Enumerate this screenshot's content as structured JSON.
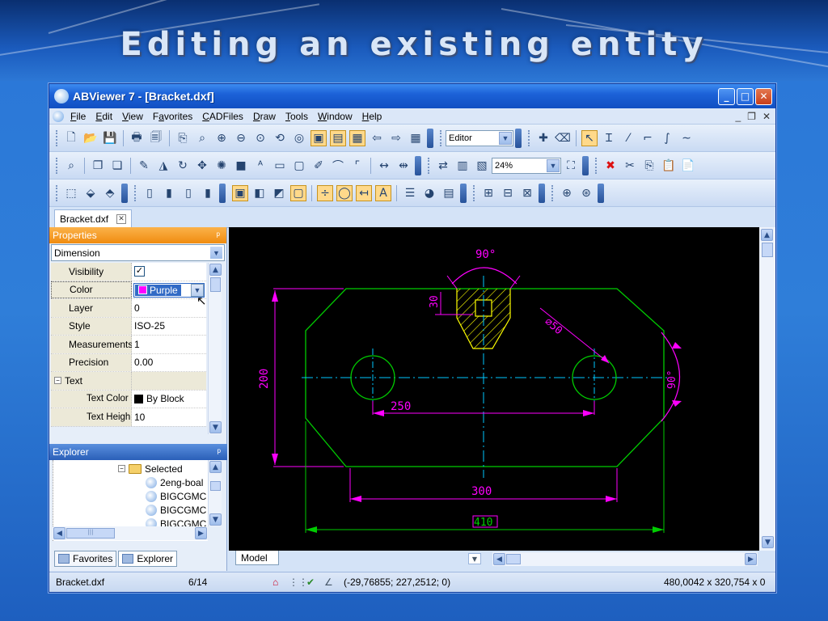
{
  "slide": {
    "title": "Editing an existing entity"
  },
  "window": {
    "title": "ABViewer 7 - [Bracket.dxf]",
    "buttons": {
      "minimize": "_",
      "maximize": "□",
      "close": "✕"
    }
  },
  "menu": {
    "items": [
      "File",
      "Edit",
      "View",
      "Favorites",
      "CADFiles",
      "Draw",
      "Tools",
      "Window",
      "Help"
    ],
    "accel": [
      "F",
      "E",
      "V",
      "a",
      "C",
      "D",
      "T",
      "W",
      "H"
    ],
    "mdi": {
      "minimize": "_",
      "restore": "❐",
      "close": "✕"
    }
  },
  "toolbar": {
    "mode_combo": "Editor",
    "zoom_combo": "24%"
  },
  "doc_tabs": [
    {
      "label": "Bracket.dxf"
    }
  ],
  "properties": {
    "header": "Properties",
    "pin": "ᵖ",
    "entity_type": "Dimension",
    "rows": [
      {
        "name": "Visibility",
        "value": "✓",
        "kind": "check"
      },
      {
        "name": "Color",
        "value": "Purple",
        "kind": "color-select",
        "color": "#ff00ff"
      },
      {
        "name": "Layer",
        "value": "0"
      },
      {
        "name": "Style",
        "value": "ISO-25"
      },
      {
        "name": "Measurements",
        "value": "1"
      },
      {
        "name": "Precision",
        "value": "0.00"
      },
      {
        "name": "Text",
        "value": "",
        "kind": "group",
        "expander": "−"
      },
      {
        "name": "Text Color",
        "value": "By Block",
        "kind": "swatch",
        "color": "#000000",
        "sub": true
      },
      {
        "name": "Text Heigh",
        "value": "10",
        "sub": true
      }
    ]
  },
  "explorer": {
    "header": "Explorer",
    "pin": "ᵖ",
    "items": [
      {
        "label": "Selected",
        "type": "folder",
        "expander": "−"
      },
      {
        "label": "2eng-boal",
        "type": "file"
      },
      {
        "label": "BIGCGMC",
        "type": "file"
      },
      {
        "label": "BIGCGMC",
        "type": "file"
      },
      {
        "label": "BIGCGMC",
        "type": "file"
      }
    ],
    "scroll_mark": "|||"
  },
  "bottom_tabs": [
    {
      "label": "Favorites"
    },
    {
      "label": "Explorer"
    }
  ],
  "drawing": {
    "colors": {
      "green": "#00ff00",
      "magenta": "#ff00ff",
      "cyan": "#00c8ff",
      "yellow": "#ffff00",
      "outline_green": "#00cc00"
    },
    "labels": {
      "angle_top": "90°",
      "dim_30": "30",
      "diameter": "⌀50",
      "dim_200": "200",
      "angle_right": "90°",
      "dim_250": "250",
      "dim_300": "300",
      "dim_410": "410"
    }
  },
  "canvas_tabs": {
    "model": "Model"
  },
  "status": {
    "file": "Bracket.dxf",
    "page": "6/14",
    "coords": "(-29,76855; 227,2512; 0)",
    "size": "480,0042 x 320,754 x 0"
  },
  "icons": {
    "up": "▲",
    "down": "▼",
    "left": "◀",
    "right": "▶",
    "dropdown": "▼"
  }
}
